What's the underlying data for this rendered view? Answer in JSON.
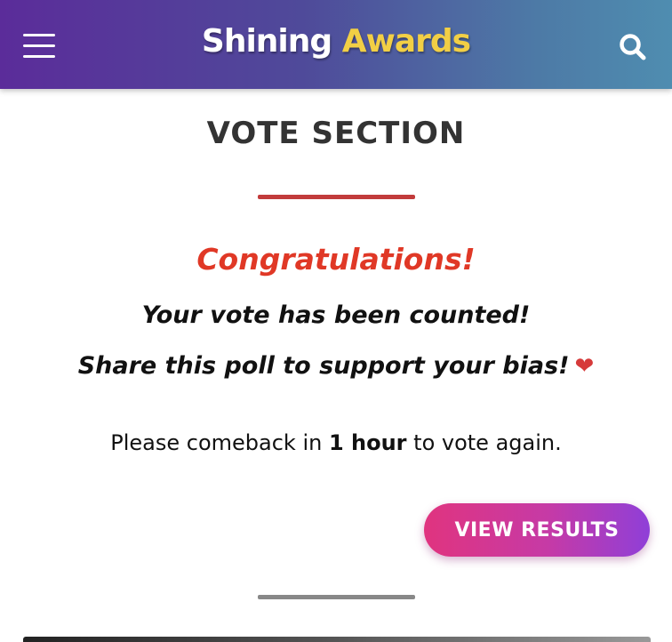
{
  "header": {
    "logo_part1": "Shining",
    "logo_part2": "Awards",
    "menu_icon": "hamburger-menu-icon",
    "search_icon": "search-icon",
    "colors": {
      "gradient_start": "#5b2c9a",
      "gradient_end": "#4f8db0",
      "logo_accent": "#f2cf45"
    }
  },
  "main": {
    "title": "VOTE SECTION",
    "congrats": "Congratulations!",
    "counted": "Your vote has been counted!",
    "share": "Share this poll to support your bias!",
    "heart_icon": "heart-icon",
    "comeback_before": "Please comeback in ",
    "comeback_bold": "1 hour",
    "comeback_after": " to vote again.",
    "view_results_label": "VIEW RESULTS",
    "colors": {
      "congrats": "#e03826",
      "divider": "#c23b3b",
      "button_start": "#e0347f",
      "button_end": "#8f3fd8"
    }
  }
}
